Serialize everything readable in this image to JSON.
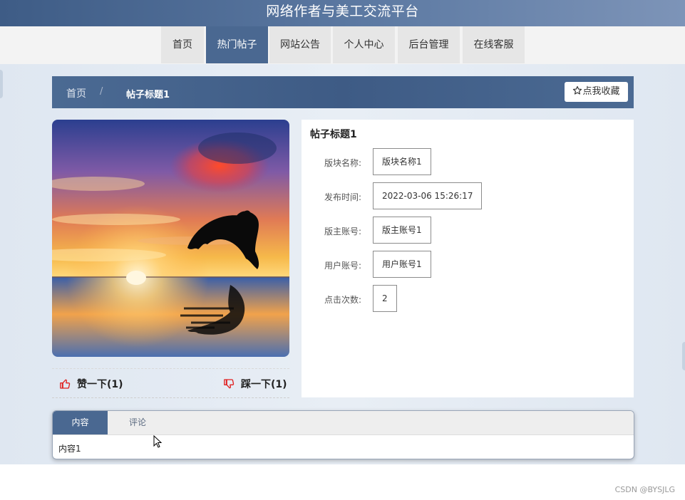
{
  "header": {
    "title": "网络作者与美工交流平台"
  },
  "nav": [
    {
      "label": "首页",
      "active": false
    },
    {
      "label": "热门帖子",
      "active": true
    },
    {
      "label": "网站公告",
      "active": false
    },
    {
      "label": "个人中心",
      "active": false
    },
    {
      "label": "后台管理",
      "active": false
    },
    {
      "label": "在线客服",
      "active": false
    }
  ],
  "breadcrumb": {
    "home": "首页",
    "separator": "/",
    "current": "帖子标题1"
  },
  "favorite": {
    "icon": "star-outline-icon",
    "label": "点我收藏"
  },
  "image": {
    "subject": "dolphin-sunset-photo"
  },
  "votes": {
    "like_icon": "thumbs-up-icon",
    "like_label": "赞一下(1)",
    "dislike_icon": "thumbs-down-icon",
    "dislike_label": "踩一下(1)"
  },
  "post": {
    "title": "帖子标题1",
    "fields": [
      {
        "label": "版块名称:",
        "value": "版块名称1"
      },
      {
        "label": "发布时间:",
        "value": "2022-03-06 15:26:17"
      },
      {
        "label": "版主账号:",
        "value": "版主账号1"
      },
      {
        "label": "用户账号:",
        "value": "用户账号1"
      },
      {
        "label": "点击次数:",
        "value": "2"
      }
    ]
  },
  "tabs": [
    {
      "label": "内容",
      "active": true
    },
    {
      "label": "评论",
      "active": false
    }
  ],
  "content_text": "内容1",
  "watermark": "CSDN @BYSJLG",
  "colors": {
    "primary": "#4a6891",
    "header": "#3e5c86",
    "like": "#e02020"
  }
}
